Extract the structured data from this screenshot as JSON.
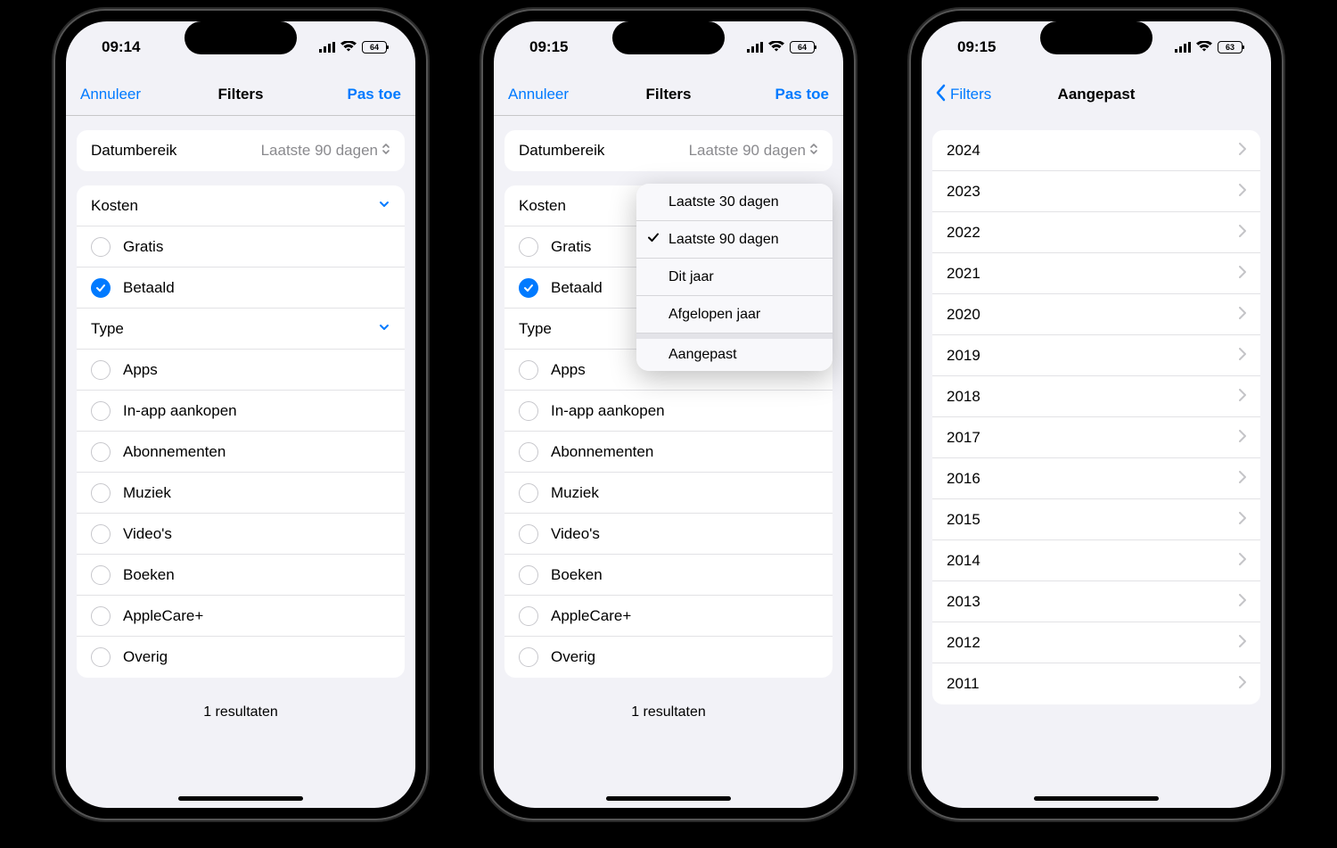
{
  "phones": [
    {
      "statusTime": "09:14",
      "battery": "64",
      "nav": {
        "left": "Annuleer",
        "title": "Filters",
        "right": "Pas toe"
      },
      "dateRange": {
        "label": "Datumbereik",
        "value": "Laatste 90 dagen"
      },
      "costs": {
        "header": "Kosten",
        "options": [
          {
            "label": "Gratis",
            "checked": false
          },
          {
            "label": "Betaald",
            "checked": true
          }
        ]
      },
      "type": {
        "header": "Type",
        "options": [
          {
            "label": "Apps"
          },
          {
            "label": "In-app aankopen"
          },
          {
            "label": "Abonnementen"
          },
          {
            "label": "Muziek"
          },
          {
            "label": "Video's"
          },
          {
            "label": "Boeken"
          },
          {
            "label": "AppleCare+"
          },
          {
            "label": "Overig"
          }
        ]
      },
      "footer": "1 resultaten"
    },
    {
      "statusTime": "09:15",
      "battery": "64",
      "nav": {
        "left": "Annuleer",
        "title": "Filters",
        "right": "Pas toe"
      },
      "dateRange": {
        "label": "Datumbereik",
        "value": "Laatste 90 dagen"
      },
      "costs": {
        "header": "Kosten",
        "options": [
          {
            "label": "Gratis",
            "checked": false
          },
          {
            "label": "Betaald",
            "checked": true
          }
        ]
      },
      "type": {
        "header": "Type",
        "options": [
          {
            "label": "Apps"
          },
          {
            "label": "In-app aankopen"
          },
          {
            "label": "Abonnementen"
          },
          {
            "label": "Muziek"
          },
          {
            "label": "Video's"
          },
          {
            "label": "Boeken"
          },
          {
            "label": "AppleCare+"
          },
          {
            "label": "Overig"
          }
        ]
      },
      "footer": "1 resultaten",
      "popup": [
        {
          "label": "Laatste 30 dagen",
          "checked": false
        },
        {
          "label": "Laatste 90 dagen",
          "checked": true
        },
        {
          "label": "Dit jaar",
          "checked": false
        },
        {
          "label": "Afgelopen jaar",
          "checked": false
        },
        {
          "label": "Aangepast",
          "checked": false,
          "separator": true
        }
      ]
    },
    {
      "statusTime": "09:15",
      "battery": "63",
      "nav": {
        "back": "Filters",
        "title": "Aangepast"
      },
      "years": [
        "2024",
        "2023",
        "2022",
        "2021",
        "2020",
        "2019",
        "2018",
        "2017",
        "2016",
        "2015",
        "2014",
        "2013",
        "2012",
        "2011"
      ]
    }
  ]
}
